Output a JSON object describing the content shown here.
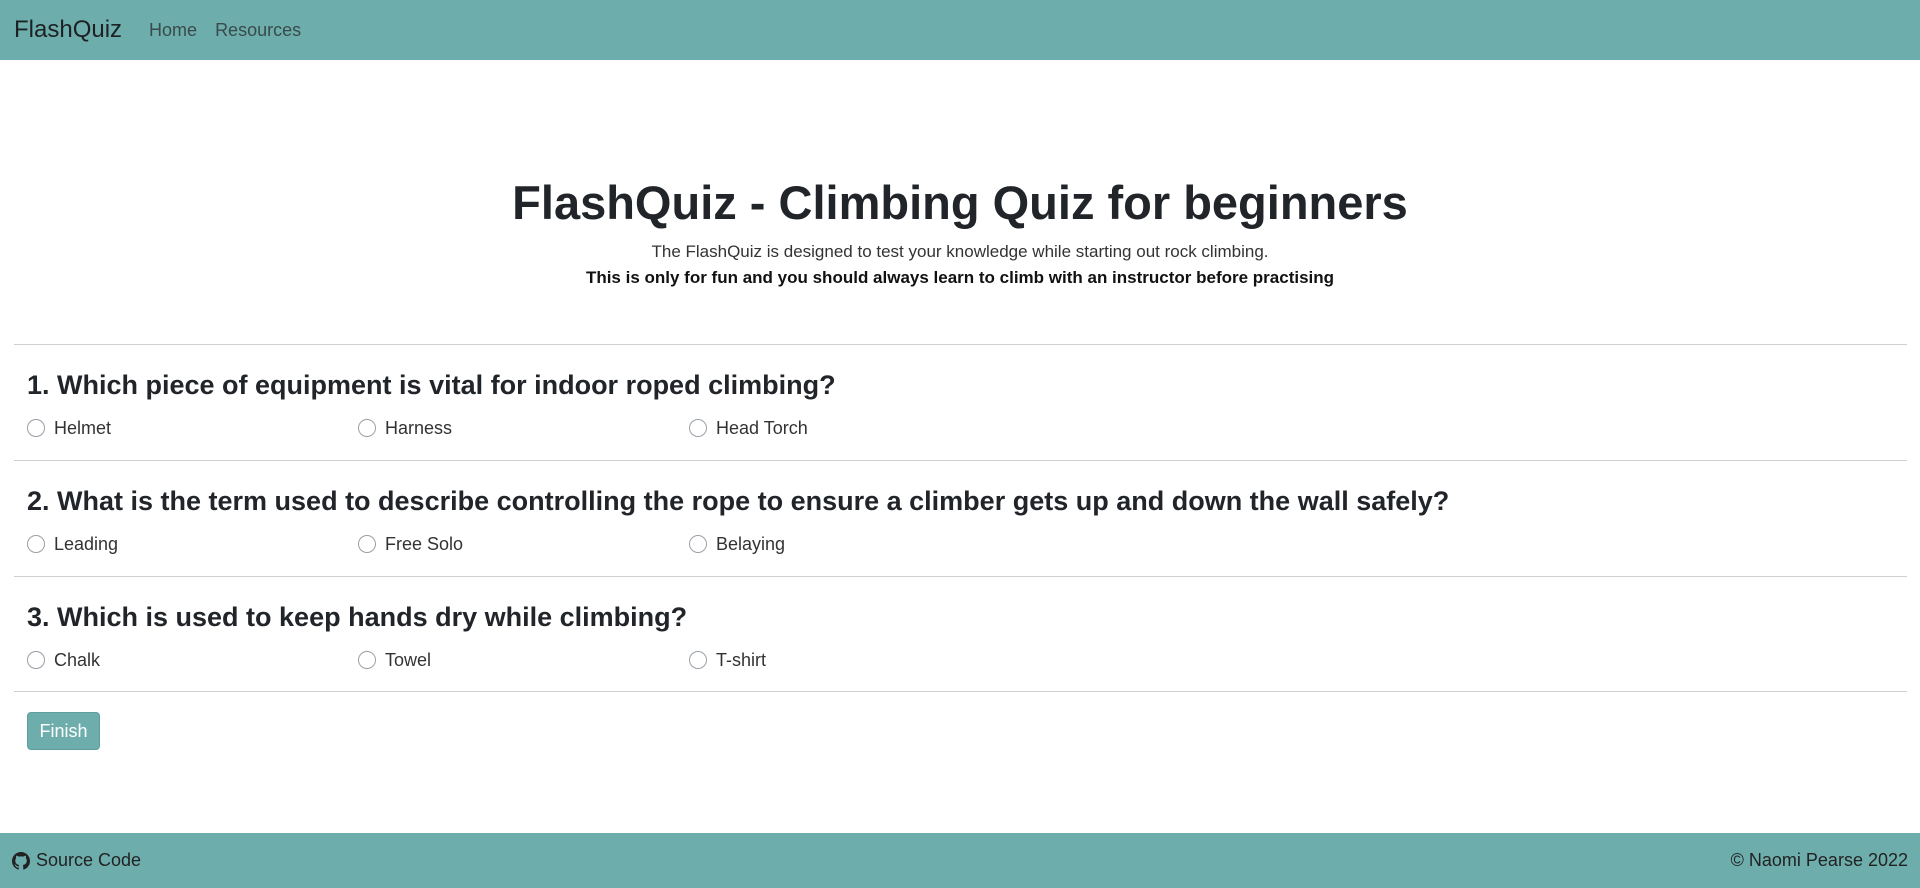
{
  "nav": {
    "brand": "FlashQuiz",
    "links": [
      "Home",
      "Resources"
    ]
  },
  "hero": {
    "title": "FlashQuiz - Climbing Quiz for beginners",
    "lead": "The FlashQuiz is designed to test your knowledge while starting out rock climbing.",
    "warning": "This is only for fun and you should always learn to climb with an instructor before practising"
  },
  "questions": [
    {
      "pre": "1. Which piece of equipment is ",
      "bold": "vital",
      "post": " for indoor roped climbing?",
      "options": [
        "Helmet",
        "Harness",
        "Head Torch"
      ]
    },
    {
      "pre": "2. What is the term used to describe controlling the rope to ensure a climber gets up and down the wall safely?",
      "bold": "",
      "post": "",
      "options": [
        "Leading",
        "Free Solo",
        "Belaying"
      ]
    },
    {
      "pre": "3. Which is used to keep hands dry while climbing?",
      "bold": "",
      "post": "",
      "options": [
        "Chalk",
        "Towel",
        "T-shirt"
      ]
    }
  ],
  "finish_label": "Finish",
  "footer": {
    "source_label": "Source Code",
    "source_icon": "github-icon",
    "copyright": "© Naomi Pearse 2022"
  },
  "colors": {
    "accent": "#6daead"
  }
}
